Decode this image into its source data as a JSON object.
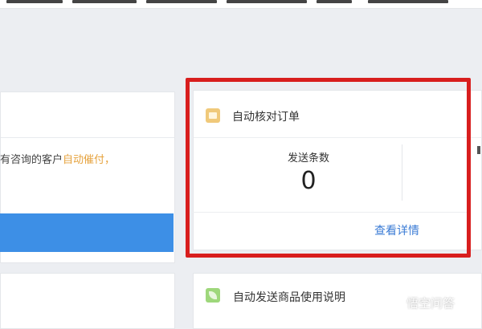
{
  "left_card": {
    "text_prefix": "有咨询的客户",
    "text_highlight": "自动催付",
    "text_suffix": "，"
  },
  "auto_check_card": {
    "title": "自动核对订单",
    "stat_label": "发送条数",
    "stat_value": "0",
    "detail_link": "查看详情",
    "icon": "calendar-icon"
  },
  "auto_send_card": {
    "title": "自动发送商品使用说明",
    "icon": "leaf-icon"
  },
  "watermark": {
    "text": "悟空问答"
  },
  "colors": {
    "highlight_border": "#d81e1e",
    "link": "#3a7bd5",
    "accent_text": "#e6a23c",
    "blue_bar": "#3d8fe6"
  }
}
